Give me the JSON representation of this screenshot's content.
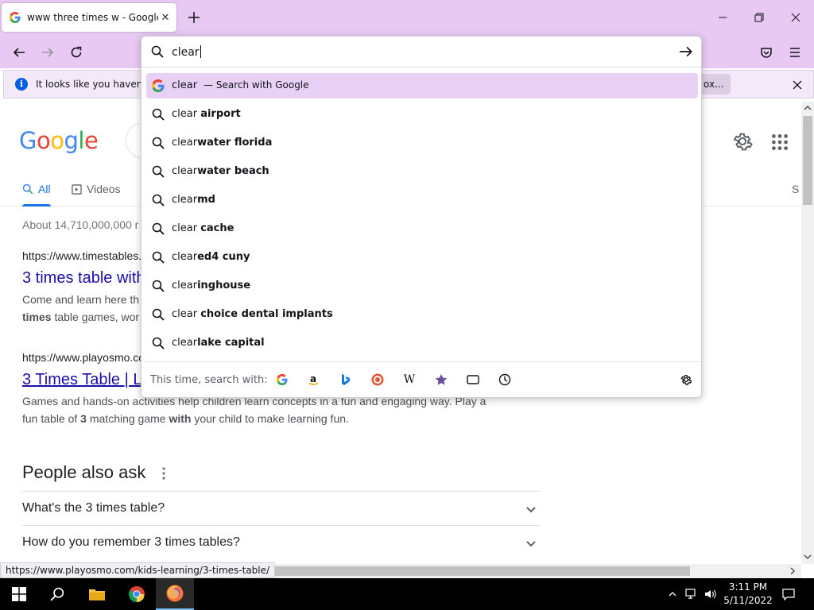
{
  "browser": {
    "tab": {
      "title": "www three times w - Google Se",
      "close_glyph": "✕"
    },
    "newtab_glyph": "+",
    "window": {
      "minimize": "—",
      "maximize": "❐",
      "close": "✕"
    }
  },
  "urlbar": {
    "query": "clear",
    "suggestions": [
      {
        "prefix": "clear",
        "suffix": "",
        "sub": "— Search with Google",
        "icon": "google-icon",
        "highlighted": true
      },
      {
        "prefix": "clear ",
        "suffix": "airport"
      },
      {
        "prefix": "clear",
        "suffix": "water florida"
      },
      {
        "prefix": "clear",
        "suffix": "water beach"
      },
      {
        "prefix": "clear",
        "suffix": "md"
      },
      {
        "prefix": "clear ",
        "suffix": "cache"
      },
      {
        "prefix": "clear",
        "suffix": "ed4 cuny"
      },
      {
        "prefix": "clear",
        "suffix": "inghouse"
      },
      {
        "prefix": "clear ",
        "suffix": "choice dental implants"
      },
      {
        "prefix": "clear",
        "suffix": "lake capital"
      }
    ],
    "oneoff_label": "This time, search with:",
    "engines": [
      "google-icon",
      "amazon-icon",
      "bing-icon",
      "duckduckgo-icon",
      "wikipedia-icon",
      "bookmarks-icon",
      "tabs-icon",
      "history-icon"
    ],
    "wiki_glyph": "W"
  },
  "notification": {
    "text": "It looks like you haven’t s",
    "button": "ox..."
  },
  "page": {
    "tabs": {
      "all": "All",
      "videos": "Videos",
      "tools_partial": "S"
    },
    "stats": "About 14,710,000,000 r",
    "results": [
      {
        "url": "https://www.timestables.",
        "title": "3 times table with",
        "snippet_1": "Come and learn here th",
        "snippet_2_bold": "times",
        "snippet_2_rest": " table games, wor"
      },
      {
        "url": "https://www.playosmo.cc",
        "title": "3 Times Table | L",
        "snippet_1": "Games and hands-on activities help children learn concepts in a fun and engaging way. Play a",
        "snippet_2a": "fun table of ",
        "snippet_2_b1": "3",
        "snippet_2b": " matching game ",
        "snippet_2_b2": "with",
        "snippet_2c": " your child to make learning fun."
      }
    ],
    "paa_title": "People also ask",
    "paa_questions": [
      "What's the 3 times table?",
      "How do you remember 3 times tables?"
    ]
  },
  "status_url": "https://www.playosmo.com/kids-learning/3-times-table/",
  "taskbar": {
    "time": "3:11 PM",
    "date": "5/11/2022"
  },
  "colors": {
    "browser_chrome": "#e8c9f3",
    "link": "#1a0dab",
    "google_blue": "#4285f4",
    "google_red": "#ea4335",
    "google_yellow": "#fbbc05",
    "google_green": "#34a853"
  }
}
